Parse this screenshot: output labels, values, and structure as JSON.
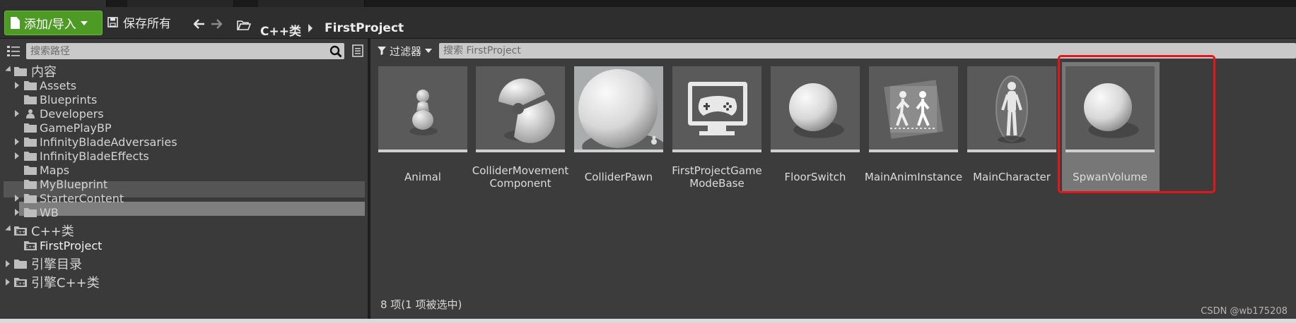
{
  "toolbar": {
    "add_import_label": "添加/导入",
    "save_all_label": "保存所有"
  },
  "breadcrumb": [
    "C++类",
    "FirstProject"
  ],
  "sources": {
    "search_placeholder": "搜索路径",
    "tree": [
      {
        "label": "内容",
        "level": 0,
        "expanded": true,
        "icon": "folder-open-icon"
      },
      {
        "label": "Assets",
        "level": 1,
        "expandable": true,
        "icon": "folder-icon"
      },
      {
        "label": "Blueprints",
        "level": 1,
        "expandable": false,
        "icon": "folder-icon"
      },
      {
        "label": "Developers",
        "level": 1,
        "expandable": true,
        "icon": "developer-folder-icon"
      },
      {
        "label": "GamePlayBP",
        "level": 1,
        "expandable": false,
        "icon": "folder-icon"
      },
      {
        "label": "InfinityBladeAdversaries",
        "level": 1,
        "expandable": true,
        "icon": "folder-icon"
      },
      {
        "label": "InfinityBladeEffects",
        "level": 1,
        "expandable": true,
        "icon": "folder-icon"
      },
      {
        "label": "Maps",
        "level": 1,
        "expandable": false,
        "icon": "folder-icon"
      },
      {
        "label": "MyBlueprint",
        "level": 1,
        "expandable": false,
        "icon": "folder-icon"
      },
      {
        "label": "StarterContent",
        "level": 1,
        "expandable": true,
        "icon": "folder-icon"
      },
      {
        "label": "WB",
        "level": 1,
        "expandable": true,
        "icon": "folder-icon"
      },
      {
        "label": "C++类",
        "level": 0,
        "expanded": true,
        "icon": "cpp-folder-icon"
      },
      {
        "label": "FirstProject",
        "level": 1,
        "expandable": false,
        "icon": "cpp-folder-icon",
        "selected": true
      },
      {
        "label": "引擎目录",
        "level": 0,
        "expandable": true,
        "icon": "folder-icon"
      },
      {
        "label": "引擎C++类",
        "level": 0,
        "expandable": true,
        "icon": "cpp-folder-icon"
      }
    ]
  },
  "content": {
    "filter_label": "过滤器",
    "search_placeholder": "搜索 FirstProject",
    "items": [
      {
        "label_lines": [
          "Animal"
        ],
        "icon": "pawn-icon"
      },
      {
        "label_lines": [
          "ColliderMovement",
          "Component"
        ],
        "icon": "component-sphere-icon"
      },
      {
        "label_lines": [
          "ColliderPawn"
        ],
        "icon": "large-sphere-icon"
      },
      {
        "label_lines": [
          "FirstProjectGame",
          "ModeBase"
        ],
        "icon": "gamepad-icon"
      },
      {
        "label_lines": [
          "FloorSwitch"
        ],
        "icon": "sphere-icon"
      },
      {
        "label_lines": [
          "MainAnimInstance"
        ],
        "icon": "anim-instance-icon"
      },
      {
        "label_lines": [
          "MainCharacter"
        ],
        "icon": "character-icon"
      },
      {
        "label_lines": [
          "SpwanVolume"
        ],
        "icon": "sphere-icon",
        "selected": true
      }
    ],
    "status": "8 项(1 项被选中)"
  },
  "watermark": "CSDN @wb175208"
}
